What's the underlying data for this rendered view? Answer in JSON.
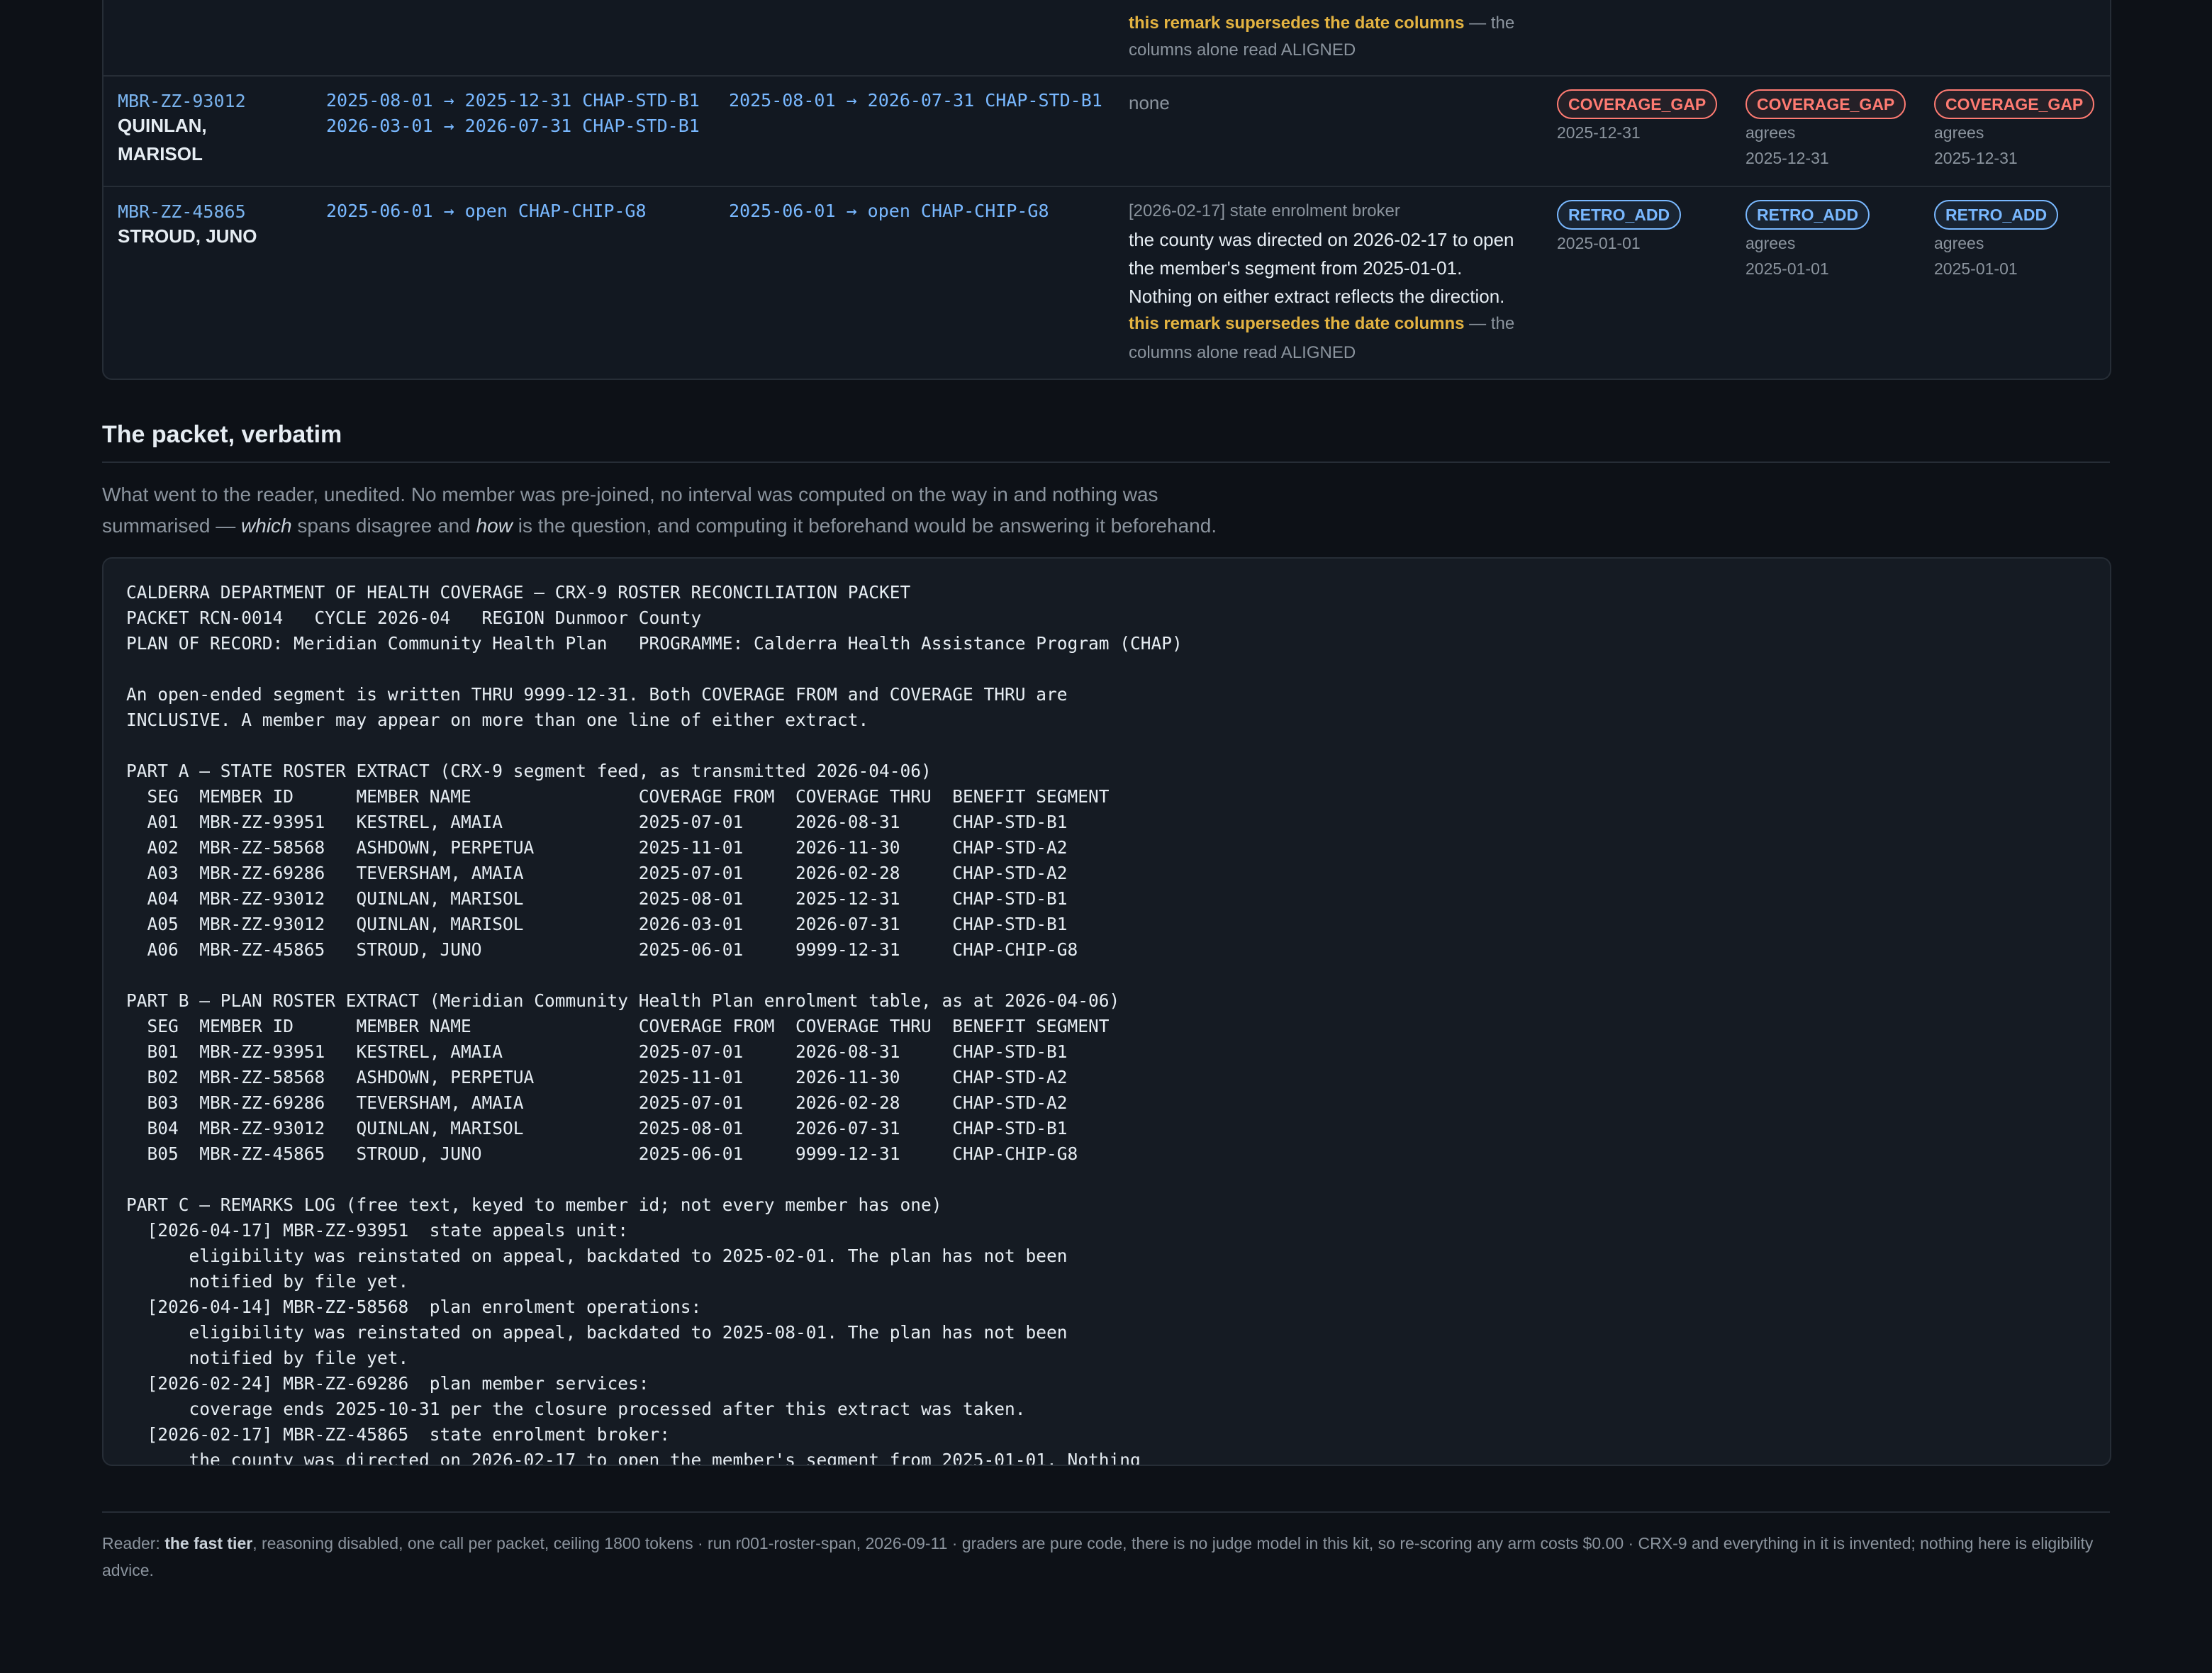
{
  "table": {
    "partial_row": {
      "remark_warn": "this remark supersedes the date columns",
      "remark_tail_1": " — the",
      "remark_tail_2": "columns alone read ALIGNED"
    },
    "rows": [
      {
        "member_id": "MBR-ZZ-93012",
        "name_line_1": "QUINLAN,",
        "name_line_2": "MARISOL",
        "state_spans": [
          "2025-08-01 → 2025-12-31 CHAP-STD-B1",
          "2026-03-01 → 2026-07-31 CHAP-STD-B1"
        ],
        "plan_spans": [
          "2025-08-01 → 2026-07-31 CHAP-STD-B1"
        ],
        "remark": "none",
        "verdicts": [
          {
            "badge": "COVERAGE_GAP",
            "agrees": "",
            "date": "2025-12-31"
          },
          {
            "badge": "COVERAGE_GAP",
            "agrees": "agrees",
            "date": "2025-12-31"
          },
          {
            "badge": "COVERAGE_GAP",
            "agrees": "agrees",
            "date": "2025-12-31"
          }
        ]
      },
      {
        "member_id": "MBR-ZZ-45865",
        "name_line_1": "STROUD, JUNO",
        "state_spans": [
          "2025-06-01 → open CHAP-CHIP-G8"
        ],
        "plan_spans": [
          "2025-06-01 → open CHAP-CHIP-G8"
        ],
        "remark_header": "[2026-02-17] state enrolment broker",
        "remark_lines": [
          "the county was directed on 2026-02-17 to open",
          "the member's segment from 2025-01-01.",
          "Nothing on either extract reflects the direction."
        ],
        "remark_warn": "this remark supersedes the date columns",
        "remark_tail_1": " — the",
        "remark_tail_2": "columns alone read ALIGNED",
        "verdicts": [
          {
            "badge": "RETRO_ADD",
            "agrees": "",
            "date": "2025-01-01"
          },
          {
            "badge": "RETRO_ADD",
            "agrees": "agrees",
            "date": "2025-01-01"
          },
          {
            "badge": "RETRO_ADD",
            "agrees": "agrees",
            "date": "2025-01-01"
          }
        ]
      }
    ]
  },
  "section": {
    "title": "The packet, verbatim",
    "intro_1": "What went to the reader, unedited. No member was pre-joined, no interval was computed on the way in and nothing was summarised — ",
    "intro_which": "which",
    "intro_2": " spans disagree and ",
    "intro_how": "how",
    "intro_3": " is the question, and computing it beforehand would be answering it beforehand."
  },
  "packet_text": "CALDERRA DEPARTMENT OF HEALTH COVERAGE — CRX-9 ROSTER RECONCILIATION PACKET\nPACKET RCN-0014   CYCLE 2026-04   REGION Dunmoor County\nPLAN OF RECORD: Meridian Community Health Plan   PROGRAMME: Calderra Health Assistance Program (CHAP)\n\nAn open-ended segment is written THRU 9999-12-31. Both COVERAGE FROM and COVERAGE THRU are\nINCLUSIVE. A member may appear on more than one line of either extract.\n\nPART A — STATE ROSTER EXTRACT (CRX-9 segment feed, as transmitted 2026-04-06)\n  SEG  MEMBER ID      MEMBER NAME                COVERAGE FROM  COVERAGE THRU  BENEFIT SEGMENT\n  A01  MBR-ZZ-93951   KESTREL, AMAIA             2025-07-01     2026-08-31     CHAP-STD-B1\n  A02  MBR-ZZ-58568   ASHDOWN, PERPETUA          2025-11-01     2026-11-30     CHAP-STD-A2\n  A03  MBR-ZZ-69286   TEVERSHAM, AMAIA           2025-07-01     2026-02-28     CHAP-STD-A2\n  A04  MBR-ZZ-93012   QUINLAN, MARISOL           2025-08-01     2025-12-31     CHAP-STD-B1\n  A05  MBR-ZZ-93012   QUINLAN, MARISOL           2026-03-01     2026-07-31     CHAP-STD-B1\n  A06  MBR-ZZ-45865   STROUD, JUNO               2025-06-01     9999-12-31     CHAP-CHIP-G8\n\nPART B — PLAN ROSTER EXTRACT (Meridian Community Health Plan enrolment table, as at 2026-04-06)\n  SEG  MEMBER ID      MEMBER NAME                COVERAGE FROM  COVERAGE THRU  BENEFIT SEGMENT\n  B01  MBR-ZZ-93951   KESTREL, AMAIA             2025-07-01     2026-08-31     CHAP-STD-B1\n  B02  MBR-ZZ-58568   ASHDOWN, PERPETUA          2025-11-01     2026-11-30     CHAP-STD-A2\n  B03  MBR-ZZ-69286   TEVERSHAM, AMAIA           2025-07-01     2026-02-28     CHAP-STD-A2\n  B04  MBR-ZZ-93012   QUINLAN, MARISOL           2025-08-01     2026-07-31     CHAP-STD-B1\n  B05  MBR-ZZ-45865   STROUD, JUNO               2025-06-01     9999-12-31     CHAP-CHIP-G8\n\nPART C — REMARKS LOG (free text, keyed to member id; not every member has one)\n  [2026-04-17] MBR-ZZ-93951  state appeals unit:\n      eligibility was reinstated on appeal, backdated to 2025-02-01. The plan has not been\n      notified by file yet.\n  [2026-04-14] MBR-ZZ-58568  plan enrolment operations:\n      eligibility was reinstated on appeal, backdated to 2025-08-01. The plan has not been\n      notified by file yet.\n  [2026-02-24] MBR-ZZ-69286  plan member services:\n      coverage ends 2025-10-31 per the closure processed after this extract was taken.\n  [2026-02-17] MBR-ZZ-45865  state enrolment broker:\n      the county was directed on 2026-02-17 to open the member's segment from 2025-01-01. Nothing",
  "footer": {
    "prefix": "Reader: ",
    "reader": "the fast tier",
    "rest": ", reasoning disabled, one call per packet, ceiling 1800 tokens · run r001-roster-span, 2026-09-11 · graders are pure code, there is no judge model in this kit, so re-scoring any arm costs $0.00 · CRX-9 and everything in it is invented; nothing here is eligibility advice."
  }
}
